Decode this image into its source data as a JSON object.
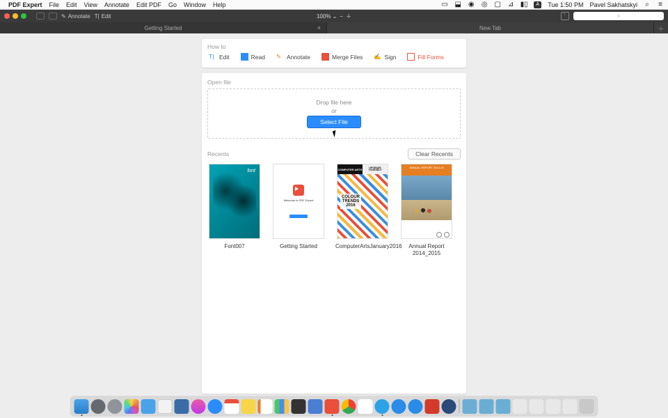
{
  "menubar": {
    "app": "PDF Expert",
    "items": [
      "File",
      "Edit",
      "View",
      "Annotate",
      "Edit PDF",
      "Go",
      "Window",
      "Help"
    ],
    "clock": "Tue 1:50 PM",
    "user": "Pavel Sakhatskyi"
  },
  "toolbar": {
    "annotate": "Annotate",
    "edit": "Edit",
    "zoom": "100% ⌄",
    "search_placeholder": "⌕"
  },
  "tabs": {
    "t1": "Getting Started",
    "t2": "New Tab"
  },
  "howto": {
    "label": "How to",
    "edit": "Edit",
    "read": "Read",
    "annotate": "Annotate",
    "merge": "Merge Files",
    "sign": "Sign",
    "fill": "Fill Forms"
  },
  "open": {
    "label": "Open file",
    "drop": "Drop file here",
    "or": "or",
    "select": "Select File"
  },
  "recents": {
    "label": "Recents",
    "clear": "Clear Recents",
    "d1": "Font007",
    "d2": "Getting Started",
    "d3": "ComputerArtsJanuary2016",
    "d4": "Annual Report 2014_2015",
    "gs_welcome": "Welcome to PDF Expert",
    "ca_left": "COMPUTER ARTS",
    "ca_right": "UPGRADE YOURSELF",
    "ar_title": "ANNUAL REPORT 2014-15"
  }
}
